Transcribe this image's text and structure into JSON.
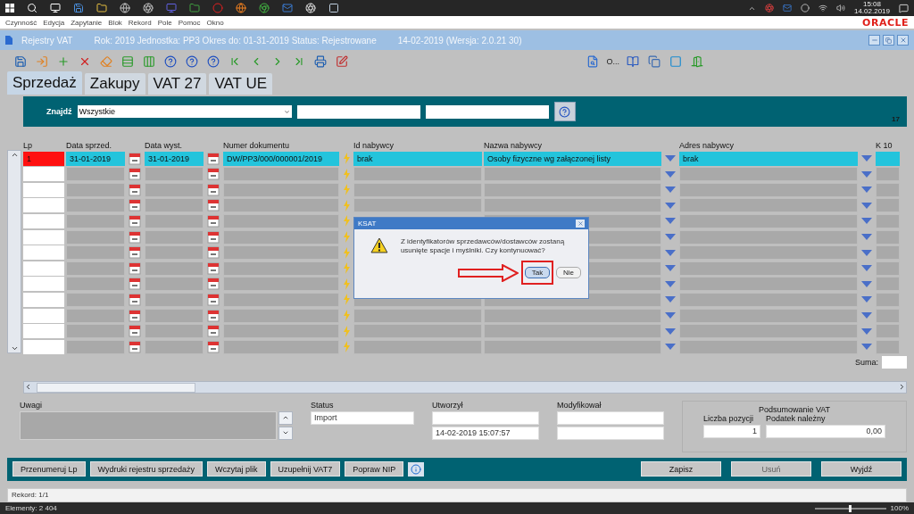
{
  "taskbar": {
    "time": "15:08",
    "date": "14.02.2019"
  },
  "menu": [
    "Czynność",
    "Edycja",
    "Zapytanie",
    "Blok",
    "Rekord",
    "Pole",
    "Pomoc",
    "Okno"
  ],
  "logo": "ORACLE",
  "window": {
    "title": "Rejestry VAT",
    "info": "Rok: 2019 Jednostka: PP3 Okres do: 01-31-2019 Status: Rejestrowane",
    "version": "14-02-2019  (Wersja: 2.0.21 30)"
  },
  "toolbar": {
    "text_button": "O..."
  },
  "tabs": [
    {
      "label": "Sprzedaż",
      "selected": true
    },
    {
      "label": "Zakupy",
      "selected": false
    },
    {
      "label": "VAT 27",
      "selected": false
    },
    {
      "label": "VAT UE",
      "selected": false
    }
  ],
  "search": {
    "label": "Znajdź",
    "filter": "Wszystkie",
    "count": "17"
  },
  "table": {
    "columns": [
      "Lp",
      "Data sprzed.",
      "Data wyst.",
      "Numer dokumentu",
      "Id nabywcy",
      "Nazwa nabywcy",
      "Adres nabywcy",
      "K 10"
    ],
    "rows": [
      {
        "lp": "1",
        "sale_date": "31-01-2019",
        "issue_date": "31-01-2019",
        "document": "DW/PP3/000/000001/2019",
        "buyer_id": "brak",
        "buyer_name": "Osoby fizyczne wg załączonej listy",
        "buyer_address": "brak",
        "selected": true
      }
    ],
    "sum_label": "Suma:"
  },
  "details": {
    "notes_label": "Uwagi",
    "status_label": "Status",
    "status": "Import",
    "created_label": "Utworzył",
    "created": "14-02-2019 15:07:57",
    "modified_label": "Modyfikował",
    "summary_title": "Podsumowanie VAT",
    "count_label": "Liczba pozycji",
    "count": "1",
    "tax_label": "Podatek należny",
    "tax": "0,00"
  },
  "actions": [
    {
      "label": "Przenumeruj Lp",
      "disabled": false
    },
    {
      "label": "Wydruki rejestru sprzedaży",
      "disabled": false
    },
    {
      "label": "Wczytaj plik",
      "disabled": false
    },
    {
      "label": "Uzupełnij VAT7",
      "disabled": false
    },
    {
      "label": "Popraw NIP",
      "disabled": false
    }
  ],
  "right_actions": [
    {
      "label": "Zapisz",
      "disabled": false
    },
    {
      "label": "Usuń",
      "disabled": true
    },
    {
      "label": "Wyjdź",
      "disabled": false
    }
  ],
  "status_bar": {
    "record": "Rekord: 1/1"
  },
  "footer": {
    "elements": "Elementy: 2 404",
    "zoom": "100%",
    "zoom_slider": {
      "level": 0.5
    }
  },
  "dialog": {
    "title": "KSAT",
    "message": "Z identyfikatorów sprzedawców/dostawców zostaną usunięte spacje i myślniki. Czy kontynuować?",
    "buttons": [
      {
        "label": "Tak",
        "selected": true
      },
      {
        "label": "Nie",
        "selected": false
      }
    ]
  }
}
